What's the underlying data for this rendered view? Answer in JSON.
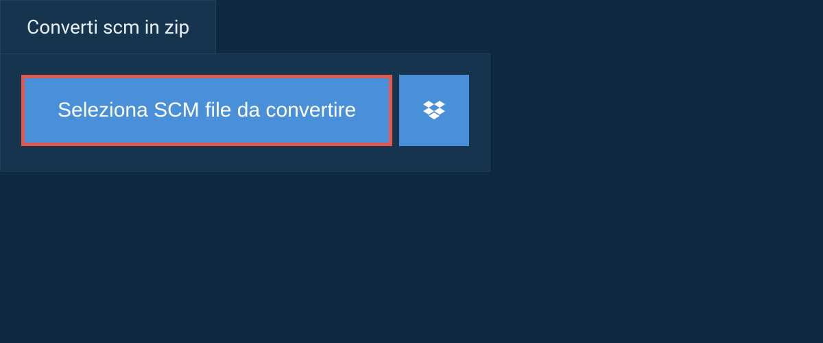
{
  "tab": {
    "label": "Converti scm in zip"
  },
  "actions": {
    "select_file_label": "Seleziona SCM file da convertire"
  }
}
